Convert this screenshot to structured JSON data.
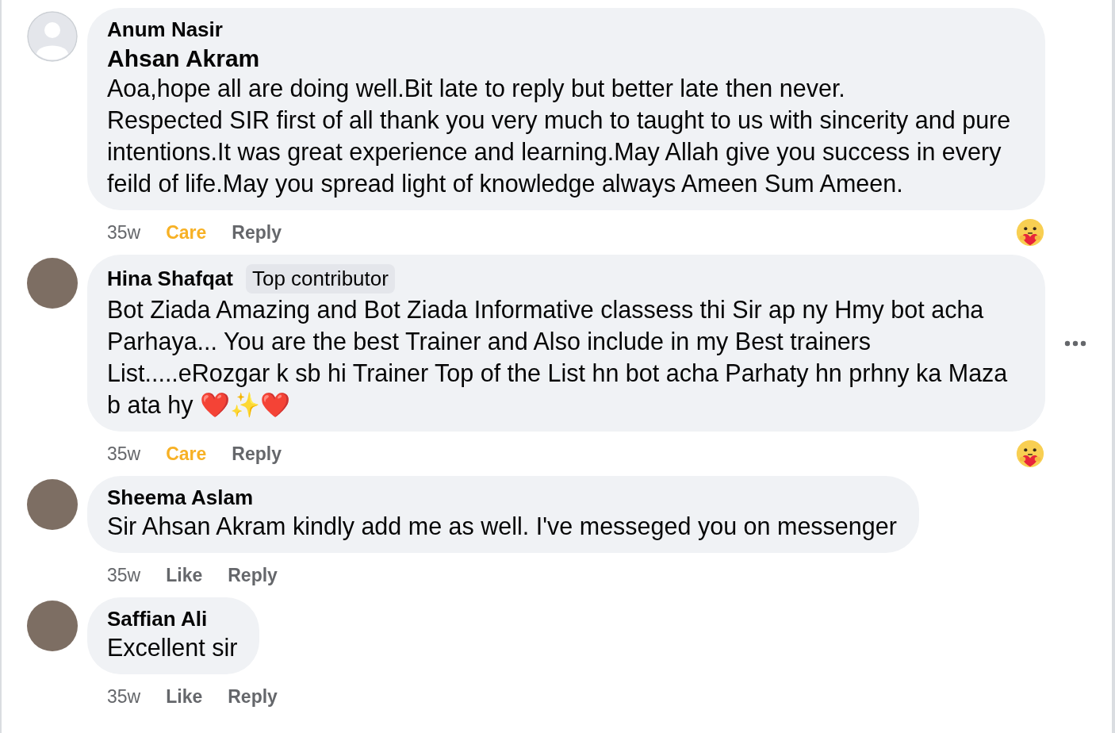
{
  "comments": [
    {
      "author": "Anum Nasir",
      "avatar": {
        "kind": "default"
      },
      "mention": "Ahsan Akram",
      "text": "Aoa,hope all are doing well.Bit late to reply but better late then never.\nRespected SIR first of all thank you very much to taught to us with sincerity and pure intentions.It was great experience and learning.May Allah give you success in every feild of life.May you spread light of knowledge always Ameen Sum Ameen.",
      "time": "35w",
      "reaction": {
        "label": "Care",
        "kind": "care"
      },
      "reply": "Reply",
      "summary": {
        "kind": "care"
      },
      "more_button": false
    },
    {
      "author": "Hina Shafqat",
      "avatar": {
        "kind": "photo"
      },
      "badge": "Top contributor",
      "text": "Bot Ziada Amazing and Bot Ziada Informative classess thi Sir ap ny Hmy bot acha Parhaya... You are the best Trainer and Also include in my Best trainers List.....eRozgar k sb hi Trainer Top of the List hn bot acha Parhaty hn prhny ka Maza b ata hy ❤️✨❤️",
      "time": "35w",
      "reaction": {
        "label": "Care",
        "kind": "care"
      },
      "reply": "Reply",
      "summary": {
        "kind": "care"
      },
      "more_button": true
    },
    {
      "author": "Sheema Aslam",
      "avatar": {
        "kind": "photo"
      },
      "text": "Sir Ahsan Akram kindly add me as well. I've messeged you on messenger",
      "time": "35w",
      "reaction": {
        "label": "Like",
        "kind": "like"
      },
      "reply": "Reply",
      "more_button": false
    },
    {
      "author": "Saffian Ali",
      "avatar": {
        "kind": "photo"
      },
      "text": "Excellent sir",
      "time": "35w",
      "reaction": {
        "label": "Like",
        "kind": "like"
      },
      "reply": "Reply",
      "more_button": false
    }
  ]
}
